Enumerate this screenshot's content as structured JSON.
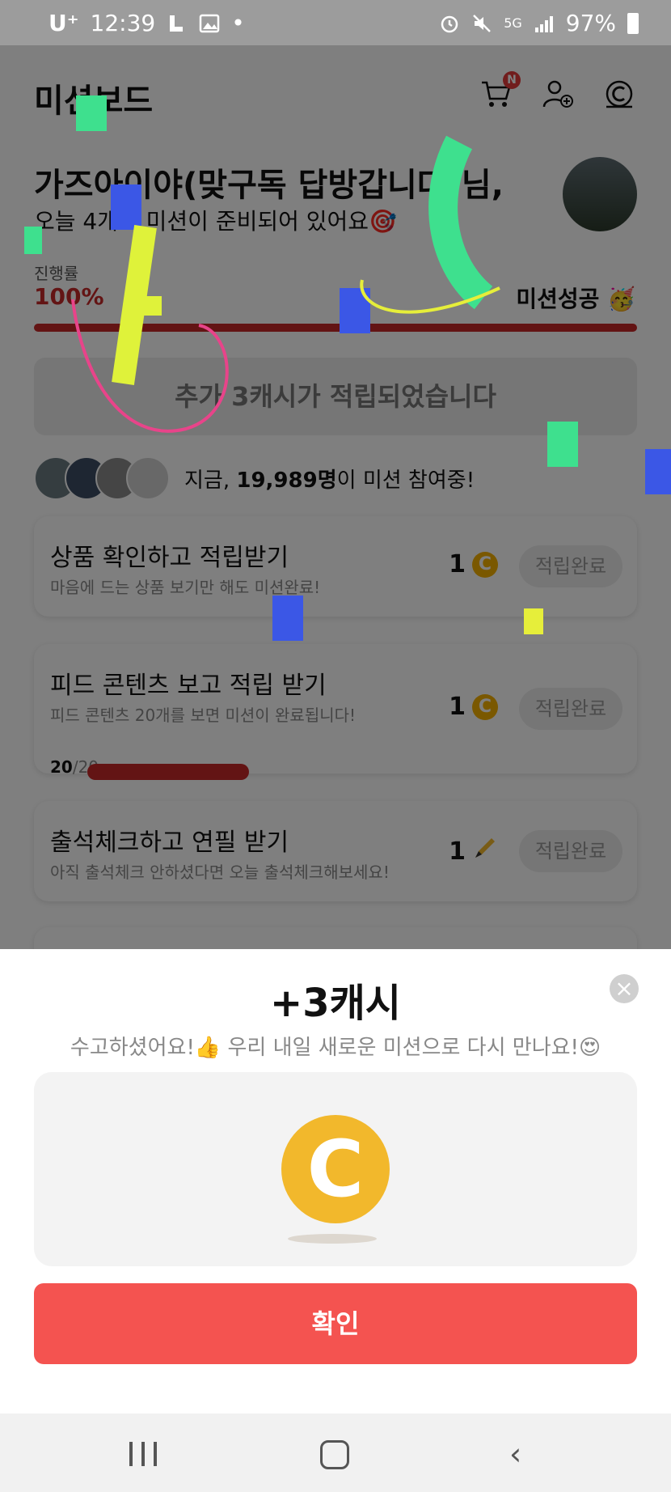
{
  "status_bar": {
    "carrier": "U⁺",
    "time": "12:39",
    "battery": "97%",
    "network": "5G"
  },
  "header": {
    "title": "미션보드",
    "cart_badge": "N"
  },
  "greeting": {
    "name_line": "가즈아이야(맞구독 답방갑니다)님,",
    "sub_line": "오늘 4개의 미션이 준비되어 있어요🎯"
  },
  "progress": {
    "label": "진행률",
    "percent": "100%",
    "value": 1.0,
    "status": "미션성공 🥳"
  },
  "notice": "추가 3캐시가 적립되었습니다",
  "participants": {
    "prefix": "지금, ",
    "count": "19,989명",
    "suffix": "이 미션 참여중!"
  },
  "missions": [
    {
      "title": "상품 확인하고 적립받기",
      "subtitle": "마음에 드는 상품 보기만 해도 미션완료!",
      "reward": "1",
      "reward_icon": "cash-coin-icon",
      "status": "적립완료"
    },
    {
      "title": "피드 콘텐츠 보고 적립 받기",
      "subtitle": "피드 콘텐츠 20개를 보면 미션이 완료됩니다!",
      "reward": "1",
      "reward_icon": "cash-coin-icon",
      "status": "적립완료",
      "count_done": "20",
      "count_total": "/20"
    },
    {
      "title": "출석체크하고 연필 받기",
      "subtitle": "아직 출석체크 안하셨다면 오늘 출석체크해보세요!",
      "reward": "1",
      "reward_icon": "pencil-icon",
      "status": "적립완료"
    }
  ],
  "modal": {
    "title": "+3캐시",
    "subtitle": "수고하셨어요!👍 우리 내일 새로운 미션으로 다시 만나요!😍",
    "coin_letter": "C",
    "confirm_label": "확인",
    "close_icon": "×"
  },
  "colors": {
    "accent_red": "#f45350",
    "progress_red": "#c62828",
    "coin_gold": "#f2b82c"
  }
}
